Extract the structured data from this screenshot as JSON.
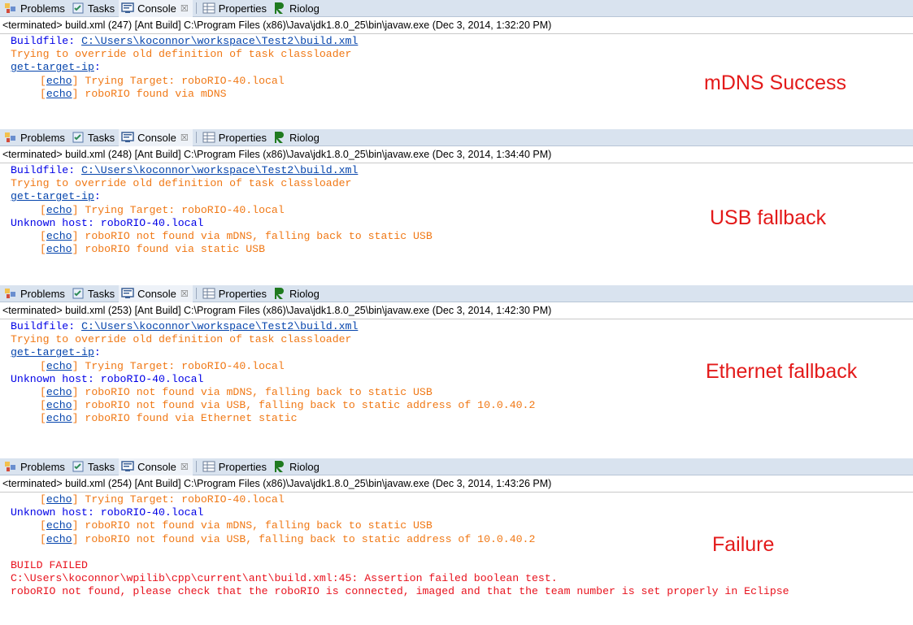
{
  "tabs": {
    "problems": "Problems",
    "tasks": "Tasks",
    "console": "Console",
    "console_close": "☒",
    "properties": "Properties",
    "riolog": "Riolog"
  },
  "panels": [
    {
      "status": "<terminated> build.xml (247) [Ant Build] C:\\Program Files (x86)\\Java\\jdk1.8.0_25\\bin\\javaw.exe (Dec 3, 2014, 1:32:20 PM)",
      "label": "mDNS Success",
      "lines": [
        {
          "type": "buildfile",
          "prefix": "Buildfile: ",
          "link": "C:\\Users\\koconnor\\workspace\\Test2\\build.xml"
        },
        {
          "type": "orange",
          "text": "Trying to override old definition of task classloader"
        },
        {
          "type": "target",
          "link": "get-target-ip",
          "suffix": ":"
        },
        {
          "type": "echo",
          "tag": "echo",
          "text": " Trying Target: roboRIO-40.local"
        },
        {
          "type": "echo",
          "tag": "echo",
          "text": " roboRIO found via mDNS"
        }
      ]
    },
    {
      "status": "<terminated> build.xml (248) [Ant Build] C:\\Program Files (x86)\\Java\\jdk1.8.0_25\\bin\\javaw.exe (Dec 3, 2014, 1:34:40 PM)",
      "label": "USB fallback",
      "lines": [
        {
          "type": "buildfile",
          "prefix": "Buildfile: ",
          "link": "C:\\Users\\koconnor\\workspace\\Test2\\build.xml"
        },
        {
          "type": "orange",
          "text": "Trying to override old definition of task classloader"
        },
        {
          "type": "target",
          "link": "get-target-ip",
          "suffix": ":"
        },
        {
          "type": "echo",
          "tag": "echo",
          "text": " Trying Target: roboRIO-40.local"
        },
        {
          "type": "blue",
          "text": "Unknown host: roboRIO-40.local"
        },
        {
          "type": "echo",
          "tag": "echo",
          "text": " roboRIO not found via mDNS, falling back to static USB"
        },
        {
          "type": "echo",
          "tag": "echo",
          "text": " roboRIO found via static USB"
        }
      ]
    },
    {
      "status": "<terminated> build.xml (253) [Ant Build] C:\\Program Files (x86)\\Java\\jdk1.8.0_25\\bin\\javaw.exe (Dec 3, 2014, 1:42:30 PM)",
      "label": "Ethernet fallback",
      "lines": [
        {
          "type": "buildfile",
          "prefix": "Buildfile: ",
          "link": "C:\\Users\\koconnor\\workspace\\Test2\\build.xml"
        },
        {
          "type": "orange",
          "text": "Trying to override old definition of task classloader"
        },
        {
          "type": "target",
          "link": "get-target-ip",
          "suffix": ":"
        },
        {
          "type": "echo",
          "tag": "echo",
          "text": " Trying Target: roboRIO-40.local"
        },
        {
          "type": "blue",
          "text": "Unknown host: roboRIO-40.local"
        },
        {
          "type": "echo",
          "tag": "echo",
          "text": " roboRIO not found via mDNS, falling back to static USB"
        },
        {
          "type": "echo",
          "tag": "echo",
          "text": " roboRIO not found via USB, falling back to static address of 10.0.40.2"
        },
        {
          "type": "echo",
          "tag": "echo",
          "text": " roboRIO found via Ethernet static"
        }
      ]
    },
    {
      "status": "<terminated> build.xml (254) [Ant Build] C:\\Program Files (x86)\\Java\\jdk1.8.0_25\\bin\\javaw.exe (Dec 3, 2014, 1:43:26 PM)",
      "label": "Failure",
      "lines": [
        {
          "type": "echo",
          "tag": "echo",
          "text": " Trying Target: roboRIO-40.local"
        },
        {
          "type": "blue",
          "text": "Unknown host: roboRIO-40.local"
        },
        {
          "type": "echo",
          "tag": "echo",
          "text": " roboRIO not found via mDNS, falling back to static USB"
        },
        {
          "type": "echo",
          "tag": "echo",
          "text": " roboRIO not found via USB, falling back to static address of 10.0.40.2"
        },
        {
          "type": "blank",
          "text": ""
        },
        {
          "type": "red",
          "text": "BUILD FAILED"
        },
        {
          "type": "red",
          "text": "C:\\Users\\koconnor\\wpilib\\cpp\\current\\ant\\build.xml:45: Assertion failed boolean test."
        },
        {
          "type": "red",
          "text": "roboRIO not found, please check that the roboRIO is connected, imaged and that the team number is set properly in Eclipse"
        }
      ]
    }
  ],
  "colors": {
    "tabbar_bg": "#d9e3ef",
    "stdout_blue": "#0000e6",
    "echo_orange": "#f07815",
    "error_red": "#e8121d",
    "annotation_red": "#e31a1a"
  }
}
